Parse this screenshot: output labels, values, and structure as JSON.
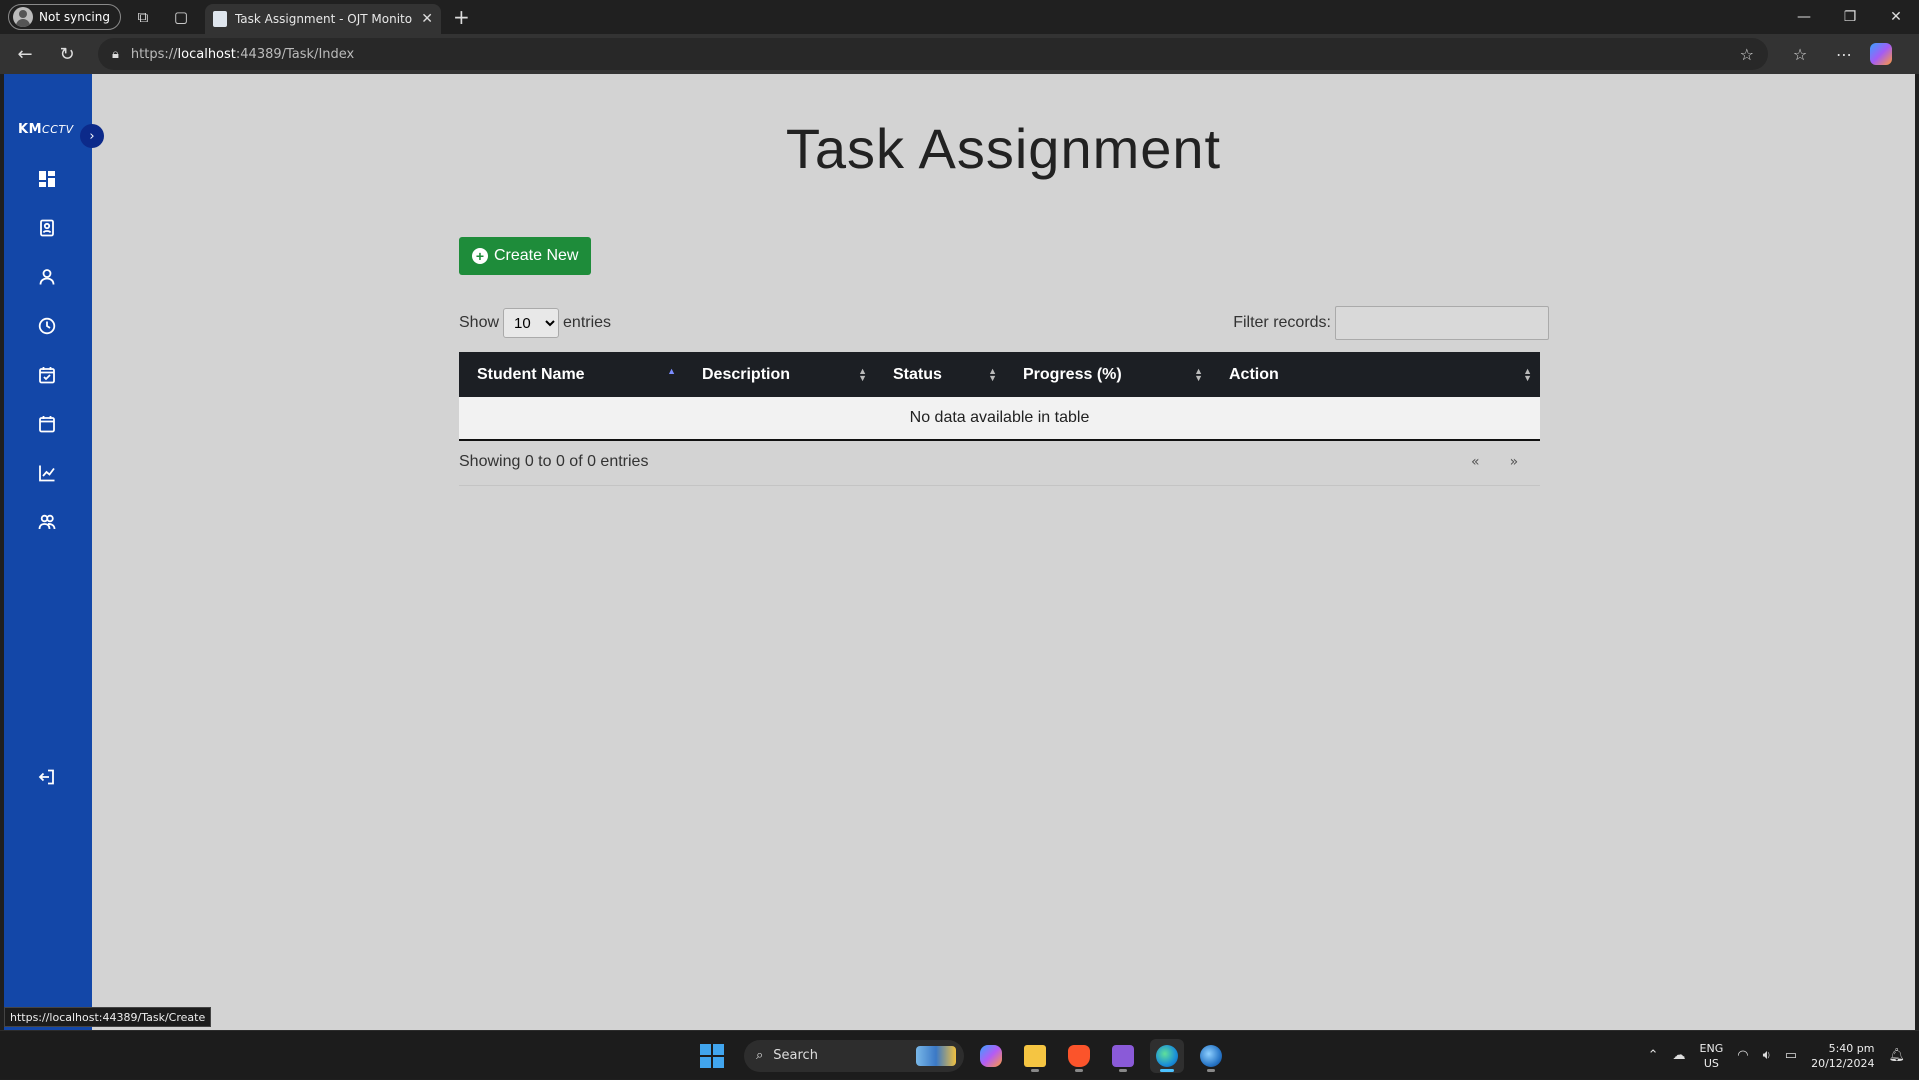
{
  "browser": {
    "profile_label": "Not syncing",
    "tab_title": "Task Assignment - OJT Monitoring",
    "url_prefix": "https://",
    "url_host": "localhost",
    "url_rest": ":44389/Task/Index"
  },
  "sidebar": {
    "logo_main": "KM",
    "logo_sub": "CCTV",
    "toggle_glyph": "›",
    "items": [
      {
        "icon": "dashboard-icon"
      },
      {
        "icon": "id-card-icon"
      },
      {
        "icon": "user-icon"
      },
      {
        "icon": "clock-icon"
      },
      {
        "icon": "calendar-check-icon"
      },
      {
        "icon": "calendar-icon"
      },
      {
        "icon": "chart-line-icon"
      },
      {
        "icon": "users-icon"
      }
    ],
    "logout_icon": "logout-icon"
  },
  "page": {
    "title": "Task Assignment",
    "create_label": "Create New"
  },
  "table_controls": {
    "show_label": "Show",
    "entries_value": "10",
    "entries_label": "entries",
    "filter_label": "Filter records:"
  },
  "table": {
    "columns": [
      "Student Name",
      "Description",
      "Status",
      "Progress (%)",
      "Action"
    ],
    "empty_message": "No data available in table",
    "info": "Showing 0 to 0 of 0 entries",
    "prev": "«",
    "next": "»"
  },
  "status_bar": {
    "link": "https://localhost:44389/Task/Create"
  },
  "taskbar": {
    "search_label": "Search",
    "lang_1": "ENG",
    "lang_2": "US",
    "time": "5:40 pm",
    "date": "20/12/2024"
  },
  "colors": {
    "sidebar": "#1347a8",
    "create_button": "#1e8c3a",
    "table_header": "#1c1f24",
    "page_background": "#d3d3d3"
  }
}
